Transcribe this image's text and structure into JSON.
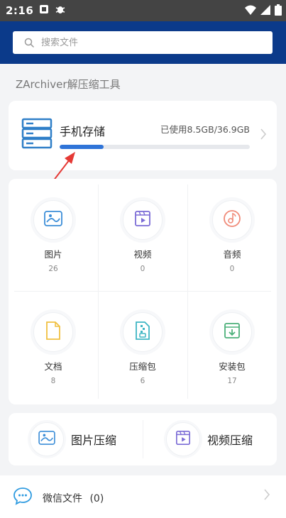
{
  "status_bar": {
    "time": "2:16"
  },
  "search": {
    "placeholder": "搜索文件"
  },
  "subtitle": "ZArchiver解压缩工具",
  "storage": {
    "label": "手机存储",
    "used_text": "已使用8.5GB/36.9GB",
    "progress_fraction": 0.23
  },
  "categories": [
    {
      "name": "图片",
      "count": "26",
      "icon": "image-icon"
    },
    {
      "name": "视频",
      "count": "0",
      "icon": "video-icon"
    },
    {
      "name": "音频",
      "count": "0",
      "icon": "music-icon"
    },
    {
      "name": "文档",
      "count": "8",
      "icon": "document-icon"
    },
    {
      "name": "压缩包",
      "count": "6",
      "icon": "archive-icon"
    },
    {
      "name": "安装包",
      "count": "17",
      "icon": "install-package-icon"
    }
  ],
  "compress": [
    {
      "name": "图片压缩",
      "icon": "image-icon"
    },
    {
      "name": "视频压缩",
      "icon": "video-icon"
    }
  ],
  "wechat": {
    "label": "微信文件",
    "count": "(0)"
  },
  "colors": {
    "header": "#0b3a8a",
    "progress": "#2f74d8",
    "annotation_arrow": "#e53935"
  }
}
